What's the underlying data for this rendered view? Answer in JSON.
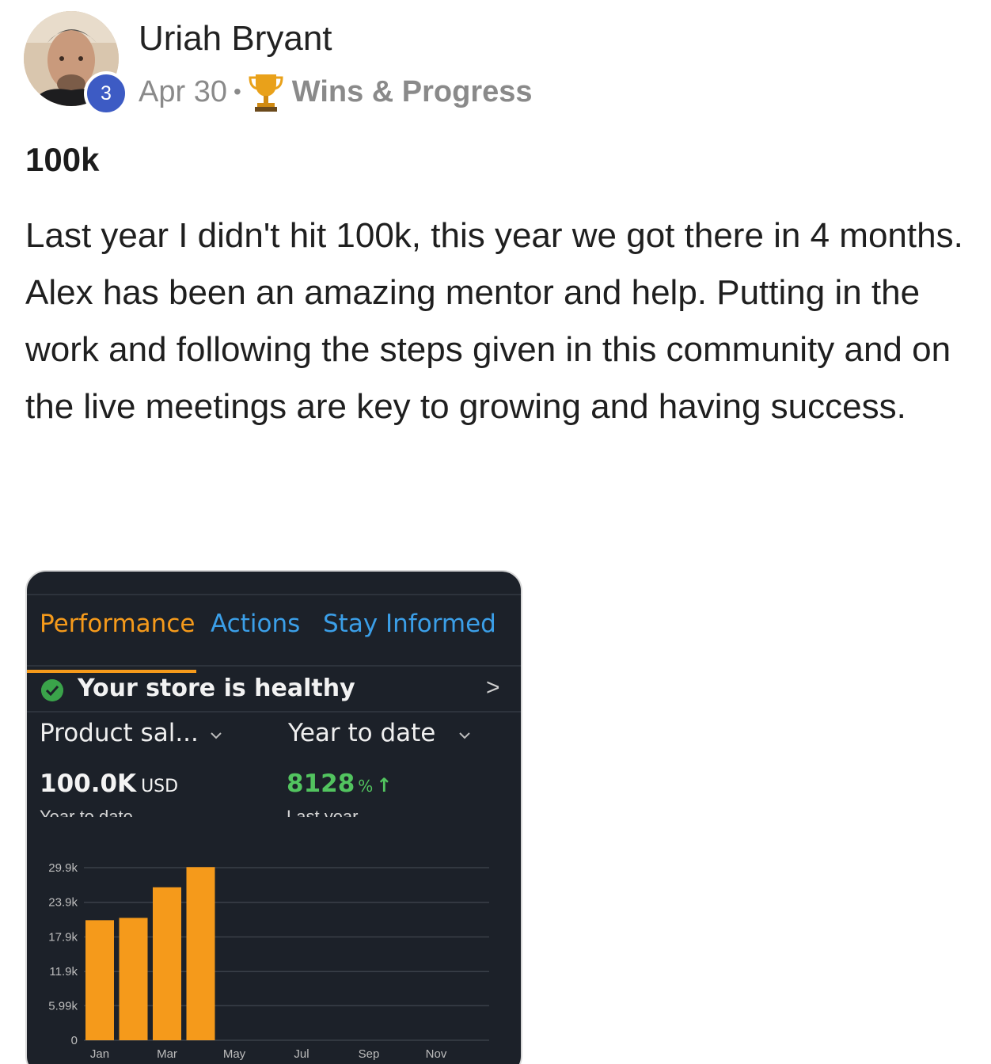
{
  "post": {
    "author_name": "Uriah Bryant",
    "level_badge": "3",
    "date": "Apr 30",
    "separator": "•",
    "category": "Wins & Progress",
    "title": "100k",
    "body": "Last year I didn't hit 100k, this year we got there in 4 months. Alex has been an amazing mentor and help. Putting in the work and following the steps given in this community and on the live meetings are key to growing and having success."
  },
  "embedded_screenshot": {
    "tabs": [
      {
        "label": "Performance",
        "active": true
      },
      {
        "label": "Actions",
        "active": false
      },
      {
        "label": "Stay Informed",
        "active": false
      }
    ],
    "status_text": "Your store is healthy",
    "metric_selector": "Product sal...",
    "period_selector": "Year to date",
    "total_value": "100.0K",
    "total_unit": "USD",
    "total_caption": "Year to date",
    "change_value": "8128",
    "change_unit": "%",
    "change_caption": "Last year",
    "colors": {
      "background": "#1c2129",
      "active_tab": "#f59a1b",
      "inactive_tab": "#3b9fe8",
      "bar": "#f59a1b",
      "positive": "#52c45f"
    }
  },
  "chart_data": {
    "type": "bar",
    "categories": [
      "Jan",
      "Feb",
      "Mar",
      "Apr",
      "May",
      "Jun",
      "Jul",
      "Aug",
      "Sep",
      "Oct",
      "Nov",
      "Dec"
    ],
    "x_tick_labels": [
      "Jan",
      "Mar",
      "May",
      "Jul",
      "Sep",
      "Nov"
    ],
    "y_tick_labels": [
      "0",
      "5.99k",
      "11.9k",
      "17.9k",
      "23.9k",
      "29.9k"
    ],
    "y_ticks": [
      0,
      5990,
      11900,
      17900,
      23900,
      29900
    ],
    "values": [
      20800,
      21200,
      26500,
      30000,
      0,
      0,
      0,
      0,
      0,
      0,
      0,
      0
    ],
    "ylim": [
      0,
      29900
    ],
    "grid": true
  }
}
